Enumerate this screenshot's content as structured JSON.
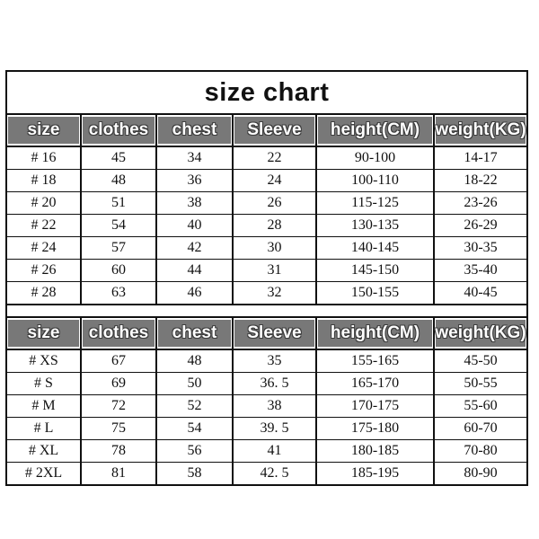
{
  "title": "size chart",
  "columns": [
    "size",
    "clothes",
    "chest",
    "Sleeve",
    "height(CM)",
    "weight(KG)"
  ],
  "colors": {
    "header_background": "#787878",
    "header_text": "#ffffff",
    "border": "#111111",
    "cell_background": "#ffffff",
    "page_background": "#ffffff"
  },
  "tables": [
    {
      "name": "kids-size-table",
      "headers": [
        "size",
        "clothes",
        "chest",
        "Sleeve",
        "height(CM)",
        "weight(KG)"
      ],
      "rows": [
        [
          "#  16",
          "45",
          "34",
          "22",
          "90-100",
          "14-17"
        ],
        [
          "#  18",
          "48",
          "36",
          "24",
          "100-110",
          "18-22"
        ],
        [
          "#  20",
          "51",
          "38",
          "26",
          "115-125",
          "23-26"
        ],
        [
          "#  22",
          "54",
          "40",
          "28",
          "130-135",
          "26-29"
        ],
        [
          "#  24",
          "57",
          "42",
          "30",
          "140-145",
          "30-35"
        ],
        [
          "#  26",
          "60",
          "44",
          "31",
          "145-150",
          "35-40"
        ],
        [
          "#  28",
          "63",
          "46",
          "32",
          "150-155",
          "40-45"
        ]
      ]
    },
    {
      "name": "adult-size-table",
      "headers": [
        "size",
        "clothes",
        "chest",
        "Sleeve",
        "height(CM)",
        "weight(KG)"
      ],
      "rows": [
        [
          "#  XS",
          "67",
          "48",
          "35",
          "155-165",
          "45-50"
        ],
        [
          "#  S",
          "69",
          "50",
          "36. 5",
          "165-170",
          "50-55"
        ],
        [
          "#  M",
          "72",
          "52",
          "38",
          "170-175",
          "55-60"
        ],
        [
          "#  L",
          "75",
          "54",
          "39. 5",
          "175-180",
          "60-70"
        ],
        [
          "#  XL",
          "78",
          "56",
          "41",
          "180-185",
          "70-80"
        ],
        [
          "#  2XL",
          "81",
          "58",
          "42. 5",
          "185-195",
          "80-90"
        ]
      ]
    }
  ]
}
